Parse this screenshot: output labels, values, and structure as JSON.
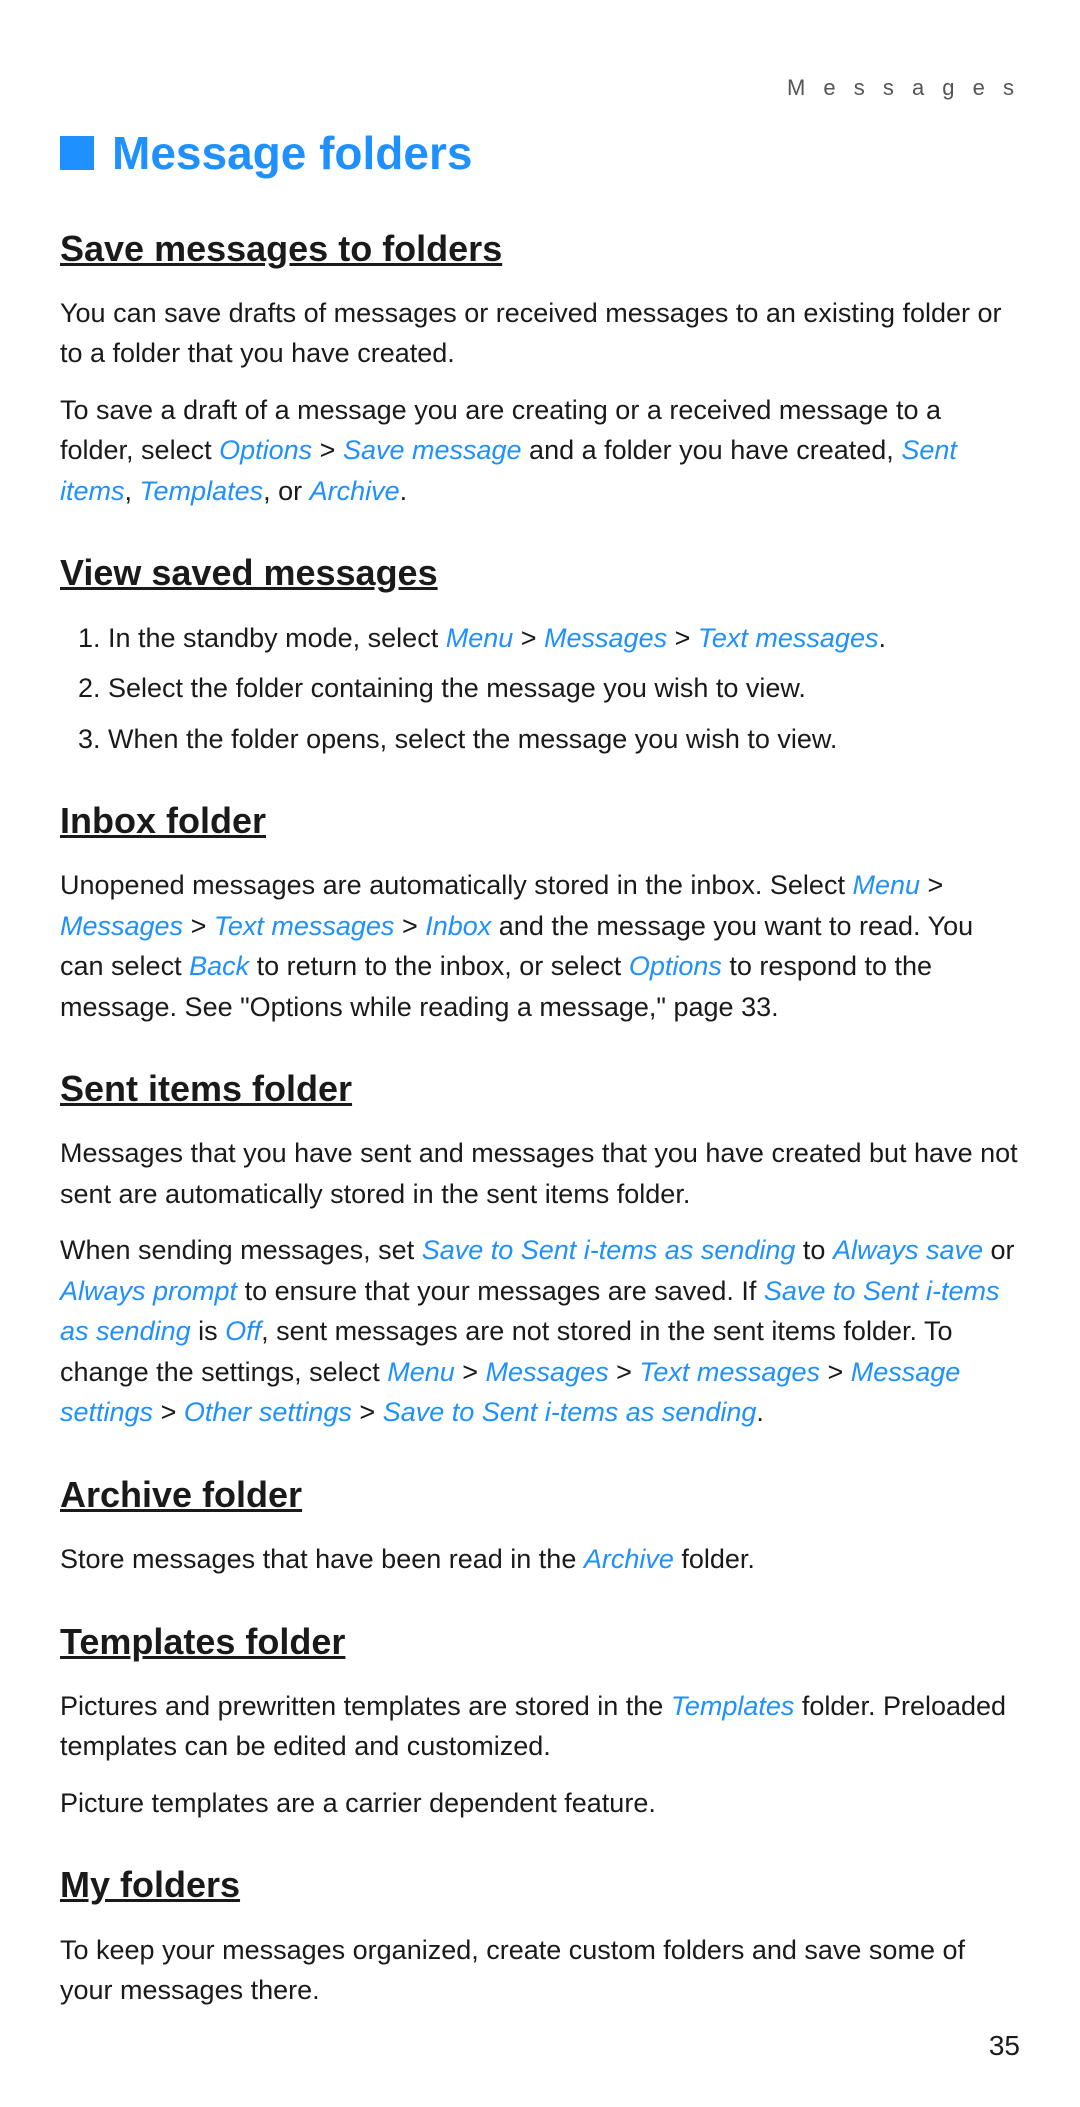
{
  "header": {
    "label": "M e s s a g e s"
  },
  "page_number": "35",
  "main_title": "Message folders",
  "sections": [
    {
      "id": "save-messages",
      "heading": "Save messages to folders",
      "paragraphs": [
        {
          "id": "p1",
          "parts": [
            {
              "text": "You can save drafts of messages or received messages to an existing folder or to a folder that you have created.",
              "type": "plain"
            }
          ]
        },
        {
          "id": "p2",
          "parts": [
            {
              "text": "To save a draft of a message you are creating or a received message to a folder, select ",
              "type": "plain"
            },
            {
              "text": "Options",
              "type": "link"
            },
            {
              "text": " > ",
              "type": "plain"
            },
            {
              "text": "Save message",
              "type": "link"
            },
            {
              "text": " and a folder you have created, ",
              "type": "plain"
            },
            {
              "text": "Sent items",
              "type": "link"
            },
            {
              "text": ", ",
              "type": "plain"
            },
            {
              "text": "Templates",
              "type": "link"
            },
            {
              "text": ", or ",
              "type": "plain"
            },
            {
              "text": "Archive",
              "type": "link"
            },
            {
              "text": ".",
              "type": "plain"
            }
          ]
        }
      ]
    },
    {
      "id": "view-saved",
      "heading": "View saved messages",
      "list": [
        {
          "parts": [
            {
              "text": "In the standby mode, select ",
              "type": "plain"
            },
            {
              "text": "Menu",
              "type": "link"
            },
            {
              "text": " > ",
              "type": "plain"
            },
            {
              "text": "Messages",
              "type": "link"
            },
            {
              "text": " > ",
              "type": "plain"
            },
            {
              "text": "Text messages",
              "type": "link"
            },
            {
              "text": ".",
              "type": "plain"
            }
          ]
        },
        {
          "parts": [
            {
              "text": "Select the folder containing the message you wish to view.",
              "type": "plain"
            }
          ]
        },
        {
          "parts": [
            {
              "text": "When the folder opens, select the message you wish to view.",
              "type": "plain"
            }
          ]
        }
      ]
    },
    {
      "id": "inbox-folder",
      "heading": "Inbox folder",
      "paragraphs": [
        {
          "id": "p1",
          "parts": [
            {
              "text": "Unopened messages are automatically stored in the inbox. Select ",
              "type": "plain"
            },
            {
              "text": "Menu",
              "type": "link"
            },
            {
              "text": " > ",
              "type": "plain"
            },
            {
              "text": "Messages",
              "type": "link"
            },
            {
              "text": " > ",
              "type": "plain"
            },
            {
              "text": "Text messages",
              "type": "link"
            },
            {
              "text": " > ",
              "type": "plain"
            },
            {
              "text": "Inbox",
              "type": "link"
            },
            {
              "text": " and the message you want to read. You can select ",
              "type": "plain"
            },
            {
              "text": "Back",
              "type": "link"
            },
            {
              "text": " to return to the inbox, or select ",
              "type": "plain"
            },
            {
              "text": "Options",
              "type": "link"
            },
            {
              "text": " to respond to the message. See \"Options while reading a message,\" page 33.",
              "type": "plain"
            }
          ]
        }
      ]
    },
    {
      "id": "sent-items",
      "heading": "Sent items folder",
      "paragraphs": [
        {
          "id": "p1",
          "parts": [
            {
              "text": "Messages that you have sent and messages that you have created but have not sent are automatically stored in the sent items folder.",
              "type": "plain"
            }
          ]
        },
        {
          "id": "p2",
          "parts": [
            {
              "text": "When sending messages, set ",
              "type": "plain"
            },
            {
              "text": "Save to Sent i-tems as sending",
              "type": "link"
            },
            {
              "text": " to ",
              "type": "plain"
            },
            {
              "text": "Always save",
              "type": "link"
            },
            {
              "text": " or ",
              "type": "plain"
            },
            {
              "text": "Always prompt",
              "type": "link"
            },
            {
              "text": " to ensure that your messages are saved. If ",
              "type": "plain"
            },
            {
              "text": "Save to Sent i-tems as sending",
              "type": "link"
            },
            {
              "text": " is ",
              "type": "plain"
            },
            {
              "text": "Off",
              "type": "link"
            },
            {
              "text": ", sent messages are not stored in the sent items folder. To change the settings, select ",
              "type": "plain"
            },
            {
              "text": "Menu",
              "type": "link"
            },
            {
              "text": " > ",
              "type": "plain"
            },
            {
              "text": "Messages",
              "type": "link"
            },
            {
              "text": " > ",
              "type": "plain"
            },
            {
              "text": "Text messages",
              "type": "link"
            },
            {
              "text": " > ",
              "type": "plain"
            },
            {
              "text": "Message settings",
              "type": "link"
            },
            {
              "text": " > ",
              "type": "plain"
            },
            {
              "text": "Other settings",
              "type": "link"
            },
            {
              "text": " > ",
              "type": "plain"
            },
            {
              "text": "Save to Sent i-tems as sending",
              "type": "link"
            },
            {
              "text": ".",
              "type": "plain"
            }
          ]
        }
      ]
    },
    {
      "id": "archive-folder",
      "heading": "Archive folder",
      "paragraphs": [
        {
          "id": "p1",
          "parts": [
            {
              "text": "Store messages that have been read in the ",
              "type": "plain"
            },
            {
              "text": "Archive",
              "type": "link"
            },
            {
              "text": " folder.",
              "type": "plain"
            }
          ]
        }
      ]
    },
    {
      "id": "templates-folder",
      "heading": "Templates folder",
      "paragraphs": [
        {
          "id": "p1",
          "parts": [
            {
              "text": "Pictures and prewritten templates are stored in the ",
              "type": "plain"
            },
            {
              "text": "Templates",
              "type": "link"
            },
            {
              "text": " folder. Preloaded templates can be edited and customized.",
              "type": "plain"
            }
          ]
        },
        {
          "id": "p2",
          "parts": [
            {
              "text": "Picture templates are a carrier dependent feature.",
              "type": "plain"
            }
          ]
        }
      ]
    },
    {
      "id": "my-folders",
      "heading": "My folders",
      "paragraphs": [
        {
          "id": "p1",
          "parts": [
            {
              "text": "To keep your messages organized, create custom folders and save some of your messages there.",
              "type": "plain"
            }
          ]
        }
      ]
    }
  ]
}
